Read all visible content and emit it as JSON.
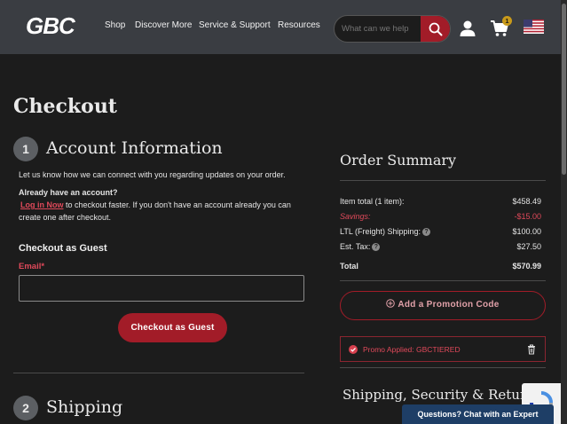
{
  "header": {
    "brand": "GBC",
    "nav": [
      "Shop",
      "Discover More",
      "Service & Support",
      "Resources"
    ],
    "search_placeholder": "What can we help",
    "cart_count": "1"
  },
  "page": {
    "title": "Checkout"
  },
  "account_section": {
    "step_number": "1",
    "title": "Account Information",
    "intro": "Let us know how we can connect with you regarding updates on your order.",
    "have_account": "Already have an account?",
    "login_link": "Log in Now",
    "login_after": "to checkout faster. If you don't have an account already you can create one after checkout.",
    "guest_heading": "Checkout as Guest",
    "email_label": "Email*",
    "email_value": "",
    "guest_button": "Checkout as Guest"
  },
  "shipping_section": {
    "step_number": "2",
    "title": "Shipping"
  },
  "order_summary": {
    "title": "Order Summary",
    "rows": [
      {
        "label": "Item total (1 item):",
        "value": "$458.49"
      },
      {
        "label": "Savings:",
        "value": "-$15.00"
      },
      {
        "label": "LTL (Freight) Shipping:",
        "value": "$100.00"
      },
      {
        "label": "Est. Tax:",
        "value": "$27.50"
      },
      {
        "label": "Total",
        "value": "$570.99"
      }
    ],
    "promo_button": "Add a Promotion Code",
    "promo_applied": "Promo Applied: GBCTIERED",
    "shipping_security_title": "Shipping, Security & Returns"
  },
  "chat": {
    "label": "Questions? Chat with an Expert"
  },
  "colors": {
    "brand_red": "#a21c28",
    "accent_red": "#e0495a",
    "header_bg": "#3a3d42",
    "page_bg": "#1c1c1c",
    "chat_blue": "#1e3e66"
  },
  "icons": [
    "search-icon",
    "account-icon",
    "cart-icon",
    "us-flag-icon",
    "plus-circle-icon",
    "check-circle-icon",
    "trash-icon",
    "info-icon"
  ]
}
